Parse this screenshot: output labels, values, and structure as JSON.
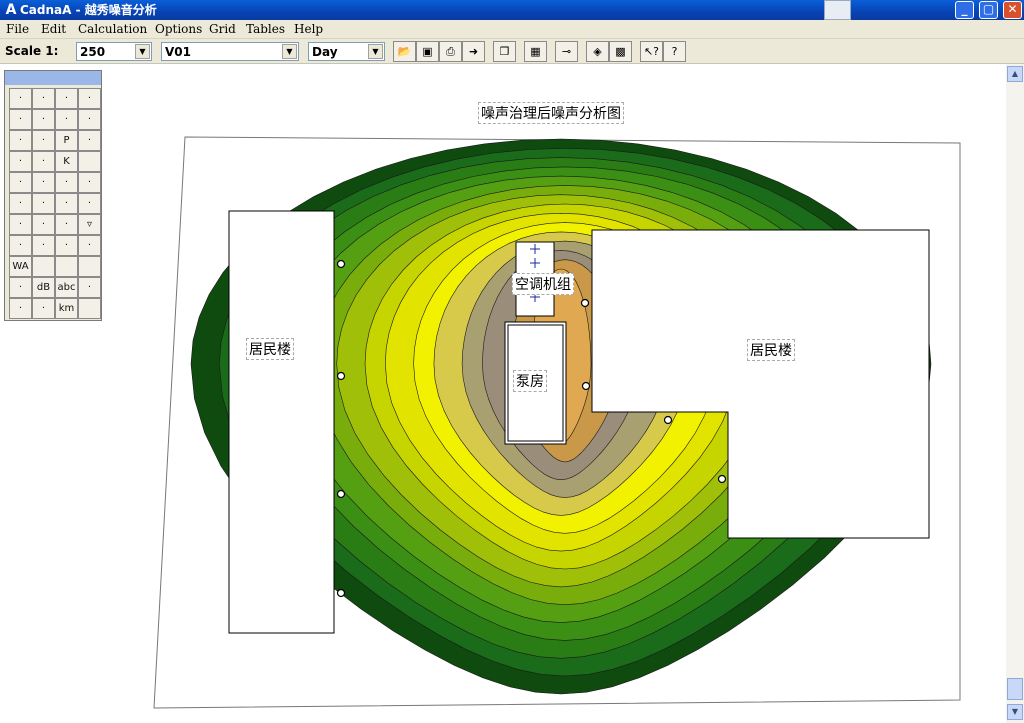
{
  "window": {
    "title": "CadnaA - 越秀噪音分析",
    "icon_glyph": "A"
  },
  "window_controls": {
    "minimize": "_",
    "maximize": "▢",
    "close": "✕"
  },
  "menu": [
    "File",
    "Edit",
    "Calculation",
    "Options",
    "Grid",
    "Tables",
    "Help"
  ],
  "toolbar": {
    "scale_label": "Scale 1:",
    "scale_value": "250",
    "variant_value": "V01",
    "period_value": "Day"
  },
  "palette": {
    "icons": [
      "pointer-icon",
      "zoom-in-icon",
      "zoom-out-icon",
      "zoom-window-icon",
      "point-source-icon",
      "line-source-icon",
      "area-source-icon",
      "vertical-area-source-icon",
      "road-icon",
      "traffic-light-icon",
      "parking-icon",
      "railway-icon",
      "tennis-icon",
      "industry-building-icon",
      "k-icon",
      "blank",
      "building-icon",
      "barrier-icon",
      "bridge-icon",
      "ground-absorption-icon",
      "tree-group-icon",
      "forest-icon",
      "cylinder-icon",
      "receiver-icon",
      "tank-icon",
      "calc-area-icon",
      "slope-icon",
      "dropdown-icon",
      "nuclear-icon",
      "grid-icon",
      "table-icon",
      "table-detail-icon",
      "va-icon",
      "blank",
      "blank",
      "blank",
      "raster-icon",
      "db-icon",
      "text-icon",
      "selection-box-icon",
      "pencil-icon",
      "arrow-up-icon",
      "km-icon",
      "blank"
    ],
    "labels": [
      "",
      "",
      "",
      "",
      "",
      "",
      "",
      "",
      "",
      "",
      "P",
      "",
      "",
      "",
      "K",
      "",
      "",
      "",
      "",
      "",
      "",
      "",
      "",
      "",
      "",
      "",
      "",
      "▿",
      "",
      "",
      "",
      "",
      "WA",
      "",
      "",
      "",
      "",
      "dB",
      "abc",
      "",
      "",
      "",
      "km",
      ""
    ]
  },
  "map": {
    "title": "噪声治理后噪声分析图",
    "building_left": "居民楼",
    "building_right": "居民楼",
    "pump_room": "泵房",
    "ac_unit": "空调机组"
  },
  "colors": {
    "contour_levels": [
      "#0f4a0f",
      "#1a6b1a",
      "#2a7d14",
      "#3a8f14",
      "#55a012",
      "#78ad0c",
      "#9fbf08",
      "#c6d400",
      "#e2e400",
      "#f2f200",
      "#d7c94a",
      "#a8a070",
      "#9a8d7a",
      "#c99848",
      "#e0a850"
    ],
    "accent_title": "#0845b8"
  }
}
